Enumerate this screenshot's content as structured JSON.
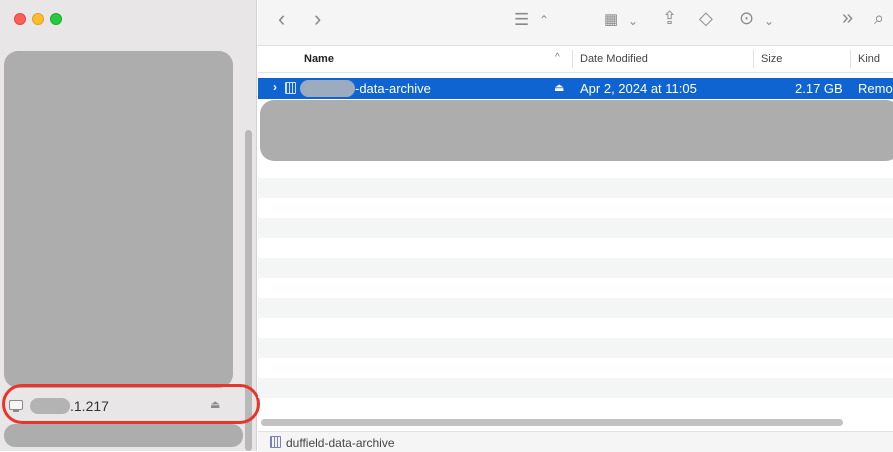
{
  "window": {
    "controls": [
      "close",
      "minimize",
      "maximize"
    ]
  },
  "sidebar": {
    "server_item": {
      "label": ".1.217",
      "icon": "display-icon",
      "eject_glyph": "⏏"
    },
    "annotation_color": "#e8342b"
  },
  "toolbar": {
    "back_glyph": "‹",
    "forward_glyph": "›",
    "list_view_glyph": "☰",
    "chevron_updown_glyph": "⌃",
    "group_glyph": "▦",
    "chevron_down_glyph": "⌄",
    "share_glyph": "⇪",
    "tag_glyph": "◇",
    "more_glyph": "⊙",
    "expand_glyph": "»",
    "search_glyph": "⌕"
  },
  "columns": {
    "name": "Name",
    "sort_glyph": "^",
    "date": "Date Modified",
    "size": "Size",
    "kind": "Kind"
  },
  "rows": [
    {
      "chevron": "›",
      "name": "-data-archive",
      "eject_glyph": "⏏",
      "date": "Apr 2, 2024 at 11:05",
      "size": "2.17 GB",
      "kind": "Remo",
      "selected": true
    }
  ],
  "pathbar": {
    "label": "duffield-data-archive"
  },
  "colors": {
    "selection": "#0f64d2",
    "sidebar_bg": "#e8e6e6",
    "redaction": "#adadad"
  }
}
